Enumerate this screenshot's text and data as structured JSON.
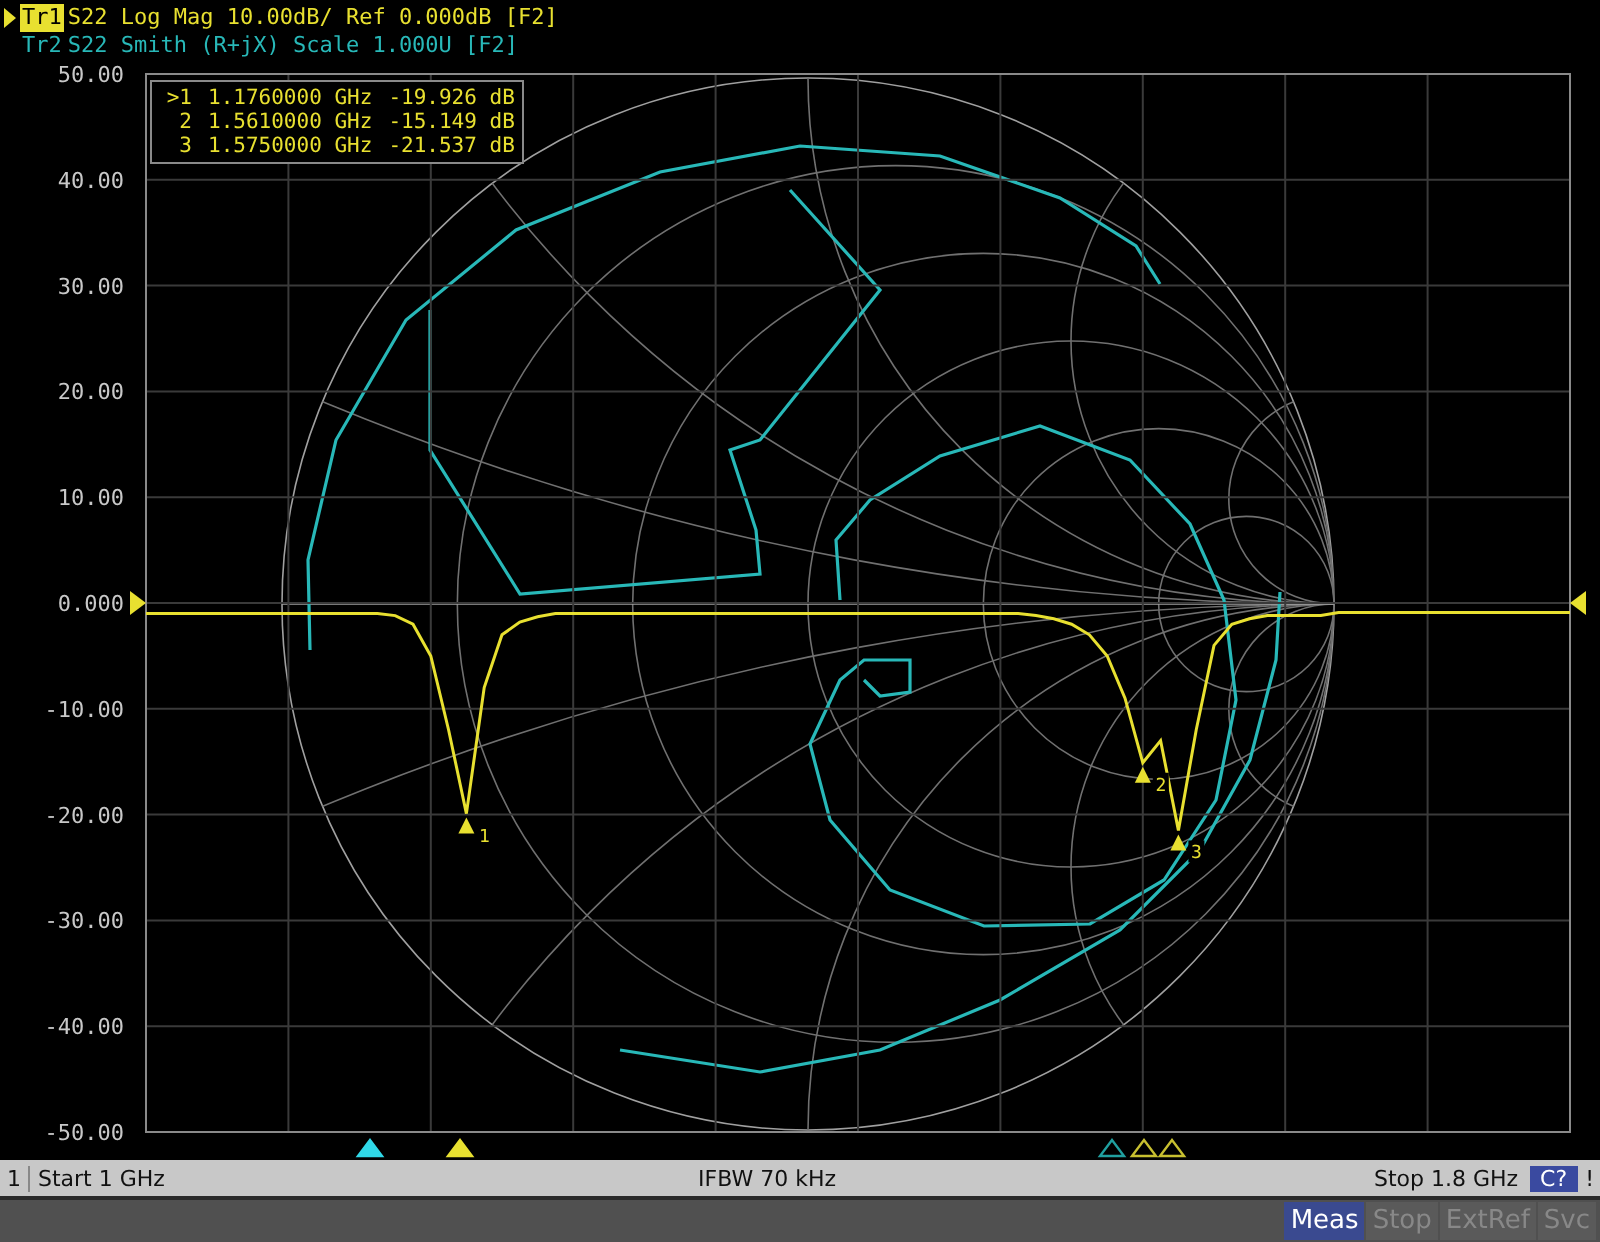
{
  "header": {
    "traces": [
      {
        "label": "Tr1",
        "selected": true,
        "text": "S22 Log Mag 10.00dB/ Ref 0.000dB [F2]",
        "color": "#e8e030"
      },
      {
        "label": "Tr2",
        "selected": false,
        "text": "S22 Smith (R+jX) Scale 1.000U [F2]",
        "color": "#28b8b8"
      }
    ]
  },
  "marker_table": [
    {
      "label": ">1",
      "frequency": "1.1760000 GHz",
      "value": "-19.926 dB"
    },
    {
      "label": "2",
      "frequency": "1.5610000 GHz",
      "value": "-15.149 dB"
    },
    {
      "label": "3",
      "frequency": "1.5750000 GHz",
      "value": "-21.537 dB"
    }
  ],
  "chart_data": {
    "type": "line",
    "ylim": [
      -50,
      50
    ],
    "grid": true,
    "yticks": [
      {
        "value": 50,
        "label": "50.00"
      },
      {
        "value": 40,
        "label": "40.00"
      },
      {
        "value": 30,
        "label": "30.00"
      },
      {
        "value": 20,
        "label": "20.00"
      },
      {
        "value": 10,
        "label": "10.00"
      },
      {
        "value": 0,
        "label": "0.000"
      },
      {
        "value": -10,
        "label": "-10.00"
      },
      {
        "value": -20,
        "label": "-20.00"
      },
      {
        "value": -30,
        "label": "-30.00"
      },
      {
        "value": -40,
        "label": "-40.00"
      },
      {
        "value": -50,
        "label": "-50.00"
      }
    ],
    "categories": [
      null,
      null,
      null,
      null,
      null,
      null,
      null,
      null,
      null,
      null,
      null,
      null,
      null,
      null,
      null,
      null,
      null,
      null,
      null,
      null,
      null,
      null,
      null,
      null,
      null,
      null,
      null,
      null,
      null,
      null,
      null,
      null,
      null,
      null,
      null,
      null,
      null,
      null,
      null,
      null,
      null,
      null,
      null,
      null,
      null,
      null,
      null,
      null,
      null,
      null,
      null,
      null,
      null,
      null,
      null,
      null,
      null,
      null,
      null,
      null,
      null,
      null,
      null,
      null,
      null,
      null,
      null,
      null,
      null,
      null,
      null,
      null,
      null,
      null,
      null,
      null,
      null,
      null,
      null,
      null,
      null
    ],
    "series": [
      {
        "color": "#e8e030",
        "values": [
          -1,
          -1,
          -1,
          -1,
          -1,
          -1,
          -1,
          -1,
          -1,
          -1,
          -1,
          -1,
          -1,
          -1,
          -1.2,
          -2,
          -5,
          -12,
          -19.9,
          -8,
          -3,
          -1.8,
          -1.3,
          -1,
          -1,
          -1,
          -1,
          -1,
          -1,
          -1,
          -1,
          -1,
          -1,
          -1,
          -1,
          -1,
          -1,
          -1,
          -1,
          -1,
          -1,
          -1,
          -1,
          -1,
          -1,
          -1,
          -1,
          -1,
          -1,
          -1,
          -1.2,
          -1.5,
          -2,
          -3,
          -5,
          -9,
          -15.1,
          -13,
          -21.5,
          -12,
          -4,
          -2,
          -1.5,
          -1.2,
          -1.2,
          -1.2,
          -1.2,
          -0.9,
          -0.9,
          -0.9,
          -0.9,
          -0.9,
          -0.9,
          -0.9,
          -0.9,
          -0.9,
          -0.9,
          -0.9,
          -0.9,
          -0.9,
          -0.9
        ]
      }
    ],
    "annotations": [
      "1",
      "2",
      "3"
    ]
  },
  "stimulus_markers": [
    {
      "color": "#30d8e8",
      "active": true
    },
    {
      "color": "#e8e030",
      "active": true
    },
    {
      "color": "#20a0a0",
      "active": false
    },
    {
      "color": "#c8c030",
      "active": false
    },
    {
      "color": "#c8c030",
      "active": false
    }
  ],
  "status_bar": {
    "channel": "1",
    "start": "Start 1 GHz",
    "ifbw": "IFBW 70 kHz",
    "stop": "Stop 1.8 GHz",
    "cal": "C?",
    "alert": "!"
  },
  "soft_keys": [
    {
      "label": "Meas",
      "active": true
    },
    {
      "label": "Stop",
      "active": false
    },
    {
      "label": "ExtRef",
      "active": false
    },
    {
      "label": "Svc",
      "active": false
    }
  ]
}
